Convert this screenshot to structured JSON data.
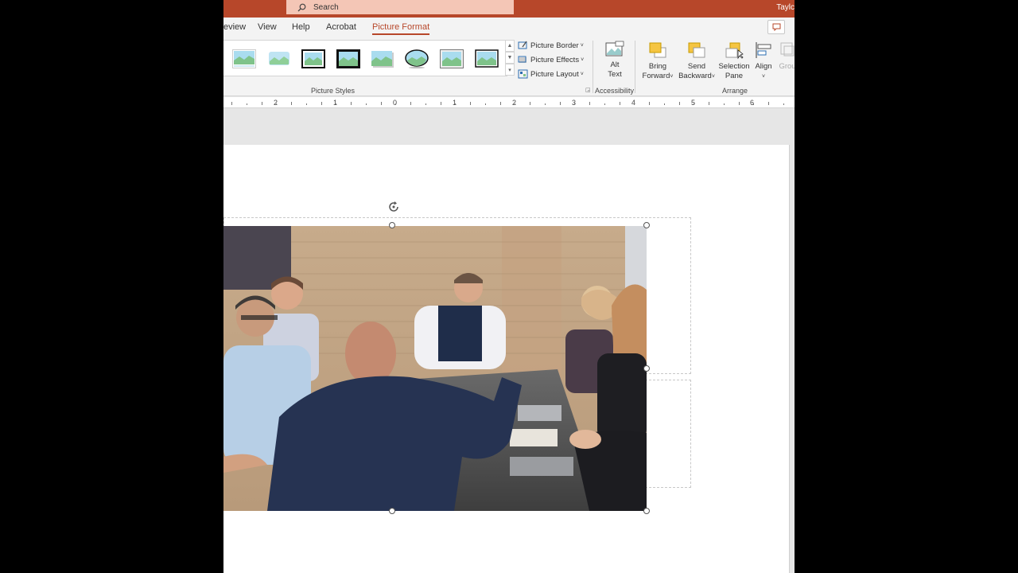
{
  "titlebar": {
    "search_placeholder": "Search",
    "user": "Taylc",
    "accent": "#b7472a"
  },
  "tabs": [
    {
      "label": "eview",
      "active": false
    },
    {
      "label": "View",
      "active": false
    },
    {
      "label": "Help",
      "active": false
    },
    {
      "label": "Acrobat",
      "active": false
    },
    {
      "label": "Picture Format",
      "active": true
    }
  ],
  "ribbon": {
    "picture_styles": {
      "label": "Picture Styles",
      "thumbnails": [
        "simple-frame-white",
        "soft-edge-rectangle",
        "simple-frame-black",
        "thick-matte-black",
        "drop-shadow-rectangle",
        "oval",
        "metal-frame",
        "reflected-rectangle"
      ],
      "commands": {
        "border": "Picture Border",
        "effects": "Picture Effects",
        "layout": "Picture Layout"
      }
    },
    "accessibility": {
      "label": "Accessibility",
      "alt_text_line1": "Alt",
      "alt_text_line2": "Text"
    },
    "arrange": {
      "label": "Arrange",
      "bring_forward_line1": "Bring",
      "bring_forward_line2": "Forward",
      "send_backward_line1": "Send",
      "send_backward_line2": "Backward",
      "selection_pane_line1": "Selection",
      "selection_pane_line2": "Pane",
      "align": "Align",
      "group": "Grou"
    }
  },
  "ruler": {
    "numbers": [
      "2",
      "1",
      "0",
      "1",
      "2",
      "3",
      "4",
      "5",
      "6"
    ]
  },
  "slide": {
    "image": "meeting-room-photo"
  }
}
